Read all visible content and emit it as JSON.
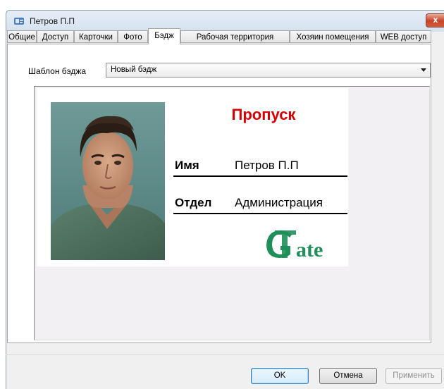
{
  "window": {
    "title": "Петров П.П",
    "close_label": "x"
  },
  "tabs": [
    {
      "label": "Общие",
      "active": false
    },
    {
      "label": "Доступ",
      "active": false
    },
    {
      "label": "Карточки",
      "active": false
    },
    {
      "label": "Фото",
      "active": false
    },
    {
      "label": "Бэдж",
      "active": true
    },
    {
      "label": "Рабочая территория",
      "active": false
    },
    {
      "label": "Хозяин помещения",
      "active": false
    },
    {
      "label": "WEB доступ",
      "active": false
    }
  ],
  "template": {
    "label": "Шаблон бэджа",
    "value": "Новый бэдж"
  },
  "badge": {
    "title": "Пропуск",
    "title_color": "#d80000",
    "name_label": "Имя",
    "name_value": "Петров П.П",
    "dept_label": "Отдел",
    "dept_value": "Администрация",
    "logo_text": "Gate",
    "logo_color": "#1f8f5a"
  },
  "buttons": {
    "ok": "OK",
    "cancel": "Отмена",
    "apply": "Применить"
  }
}
